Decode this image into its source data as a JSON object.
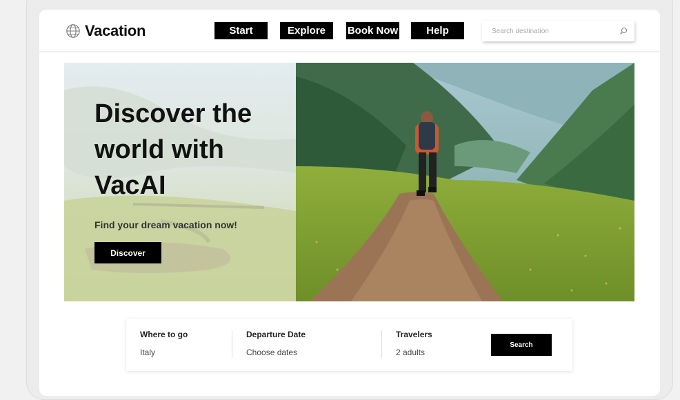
{
  "brand": {
    "name": "Vacation",
    "logo_icon": "globe-icon"
  },
  "nav": {
    "items": [
      {
        "label": "Start"
      },
      {
        "label": "Explore"
      },
      {
        "label": "Book Now"
      },
      {
        "label": "Help"
      }
    ]
  },
  "search": {
    "placeholder": "Search destination",
    "icon": "search-icon"
  },
  "hero": {
    "title": "Discover the world with VacAI",
    "subtitle": "Find your dream vacation now!",
    "cta_label": "Discover"
  },
  "booking": {
    "where": {
      "label": "Where to go",
      "value": "Italy"
    },
    "departure": {
      "label": "Departure Date",
      "value": "Choose dates"
    },
    "travelers": {
      "label": "Travelers",
      "value": "2 adults"
    },
    "search_label": "Search"
  },
  "colors": {
    "accent": "#000000",
    "background": "#ffffff",
    "frame": "#ececec"
  }
}
